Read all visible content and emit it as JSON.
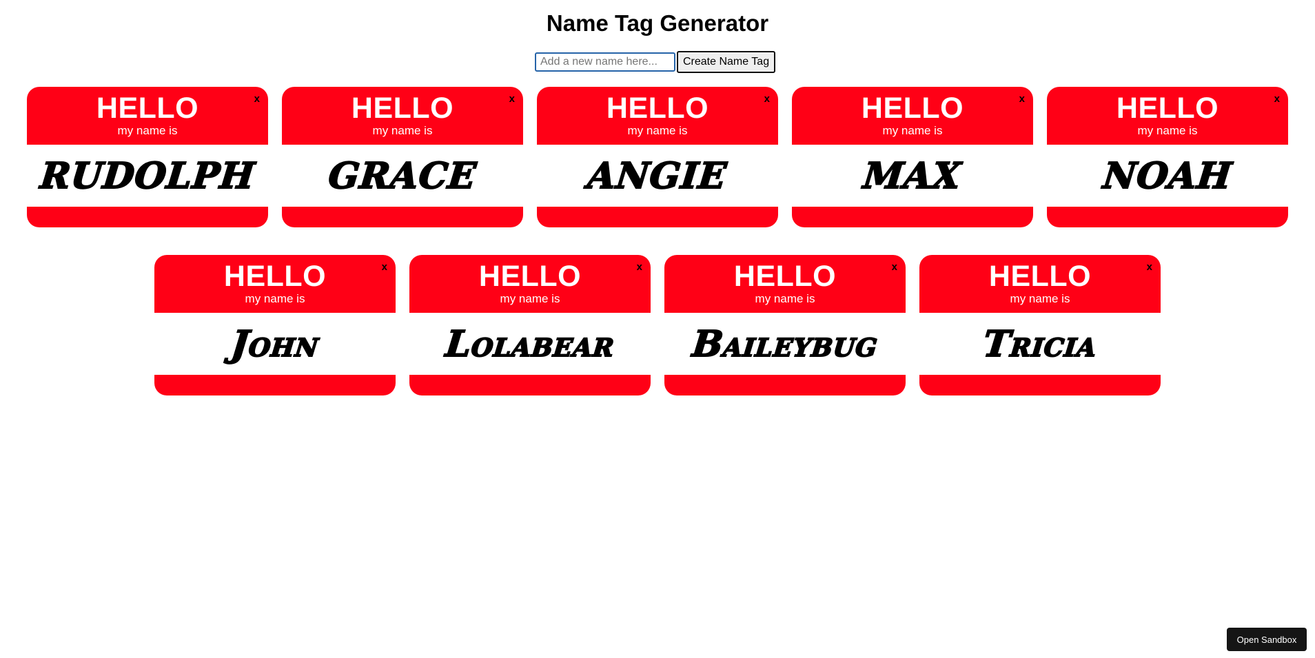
{
  "app": {
    "title": "Name Tag Generator"
  },
  "form": {
    "input_placeholder": "Add a new name here...",
    "input_value": "",
    "create_label": "Create Name Tag"
  },
  "tag_template": {
    "hello": "HELLO",
    "subtitle": "my name is",
    "close": "x"
  },
  "tags": [
    {
      "name": "RUDOLPH",
      "style": "upper"
    },
    {
      "name": "GRACE",
      "style": "upper"
    },
    {
      "name": "ANGIE",
      "style": "upper"
    },
    {
      "name": "MAX",
      "style": "upper"
    },
    {
      "name": "NOAH",
      "style": "upper"
    },
    {
      "name": "John",
      "style": "caps"
    },
    {
      "name": "Lolabear",
      "style": "caps"
    },
    {
      "name": "Baileybug",
      "style": "caps"
    },
    {
      "name": "Tricia",
      "style": "caps"
    }
  ],
  "footer": {
    "sandbox_label": "Open Sandbox"
  },
  "colors": {
    "tag_red": "#ff0016",
    "input_focus_border": "#2563a8",
    "sandbox_bg": "#151515"
  }
}
